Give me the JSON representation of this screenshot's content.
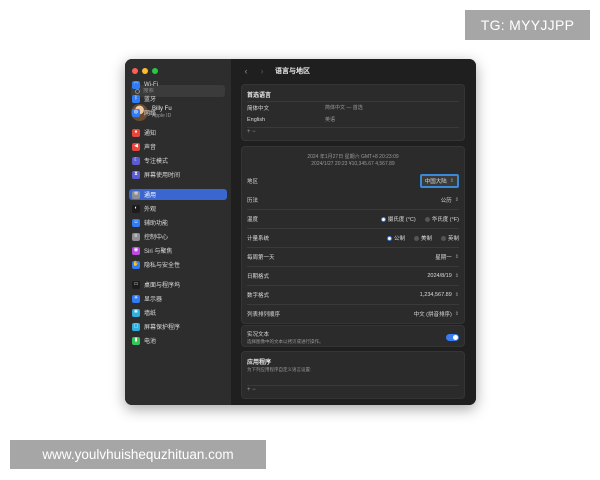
{
  "badges": {
    "tg": "TG: MYYJJPP",
    "url": "www.youlvhuishequzhituan.com"
  },
  "window": {
    "traffic_lights": {
      "close": "#ff5f57",
      "minimize": "#febc2e",
      "zoom": "#28c840"
    },
    "accent": "#3a66cf"
  },
  "sidebar": {
    "search_placeholder": "搜索",
    "user": {
      "name": "Billy Fu",
      "subtitle": "Apple ID"
    },
    "items": [
      {
        "label": "Wi-Fi",
        "icon": "wifi-icon",
        "color": "#2f7cf6"
      },
      {
        "label": "蓝牙",
        "icon": "bluetooth-icon",
        "color": "#2f7cf6"
      },
      {
        "label": "网络",
        "icon": "globe-icon",
        "color": "#2f7cf6"
      },
      {
        "label": "通知",
        "icon": "bell-icon",
        "color": "#e8453c"
      },
      {
        "label": "声音",
        "icon": "speaker-icon",
        "color": "#e8453c"
      },
      {
        "label": "专注模式",
        "icon": "moon-icon",
        "color": "#5b5bd6"
      },
      {
        "label": "屏幕使用时间",
        "icon": "hourglass-icon",
        "color": "#5b5bd6"
      },
      {
        "label": "通用",
        "icon": "gear-icon",
        "color": "#8e8e93"
      },
      {
        "label": "外观",
        "icon": "appearance-icon",
        "color": "#1c1c1e"
      },
      {
        "label": "辅助功能",
        "icon": "accessibility-icon",
        "color": "#2f7cf6"
      },
      {
        "label": "控制中心",
        "icon": "control-center-icon",
        "color": "#8e8e93"
      },
      {
        "label": "Siri 与聚焦",
        "icon": "siri-icon",
        "color": "#c04ae0"
      },
      {
        "label": "隐私与安全性",
        "icon": "hand-icon",
        "color": "#2f7cf6"
      },
      {
        "label": "桌面与程序坞",
        "icon": "dock-icon",
        "color": "#1c1c1e"
      },
      {
        "label": "显示器",
        "icon": "display-icon",
        "color": "#2f7cf6"
      },
      {
        "label": "墙纸",
        "icon": "wallpaper-icon",
        "color": "#30b0e0"
      },
      {
        "label": "屏幕保护程序",
        "icon": "screensaver-icon",
        "color": "#30b0e0"
      },
      {
        "label": "电池",
        "icon": "battery-icon",
        "color": "#34c759"
      }
    ]
  },
  "content": {
    "title": "语言与地区",
    "preferred": {
      "title": "首选语言",
      "languages": [
        {
          "name": "简体中文",
          "desc": "简体中文 — 首选"
        },
        {
          "name": "English",
          "desc": "英语"
        }
      ],
      "add_remove": "+  −"
    },
    "format_preview": {
      "line1": "2024 年1月27日 星期六 GMT+8 20:23:09",
      "line2": "2024/1/27 20:23      ¥10,345.67      4,567.89"
    },
    "settings": {
      "region": {
        "label": "地区",
        "value": "中国大陆"
      },
      "calendar": {
        "label": "历法",
        "value": "公历"
      },
      "temperature": {
        "label": "温度",
        "options": [
          "摄氏度 (°C)",
          "华氏度 (°F)"
        ],
        "selected": 0
      },
      "measurement": {
        "label": "计量系统",
        "options": [
          "公制",
          "美制",
          "英制"
        ],
        "selected": 0
      },
      "first_day": {
        "label": "每周第一天",
        "value": "星期一"
      },
      "date_format": {
        "label": "日期格式",
        "value": "2024/8/19"
      },
      "number_format": {
        "label": "数字格式",
        "value": "1,234,567.89"
      },
      "list_sort": {
        "label": "列表排列顺序",
        "value": "中文 (拼音排序)"
      }
    },
    "live_text": {
      "label": "实况文本",
      "sub": "选择图像中的文本以拷贝或进行操作。",
      "enabled": true
    },
    "apps": {
      "title": "应用程序",
      "sub": "为下列应用程序自定义语言设置:",
      "add_remove": "+  −"
    }
  }
}
